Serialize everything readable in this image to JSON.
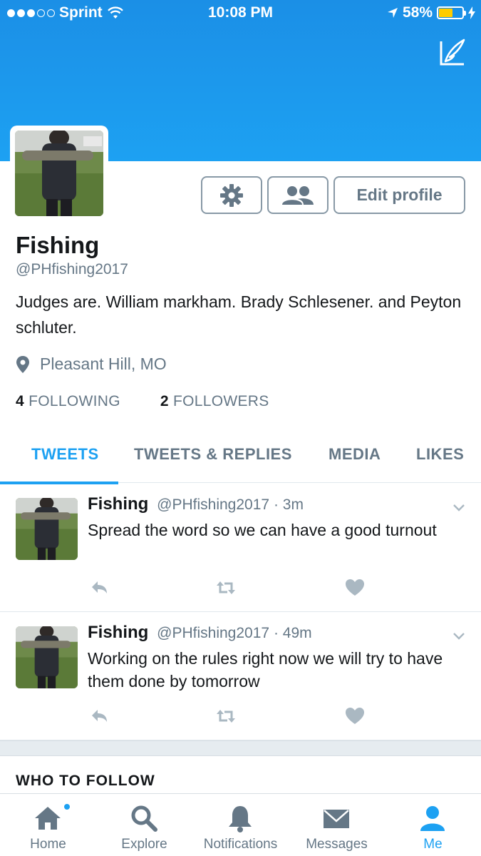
{
  "status_bar": {
    "carrier": "Sprint",
    "time": "10:08 PM",
    "battery": "58%",
    "battery_level": 0.58
  },
  "header": {
    "compose_icon": "compose-quill-icon",
    "banner_color": "#1da1f2"
  },
  "profile": {
    "name": "Fishing",
    "handle": "@PHfishing2017",
    "bio": "Judges are. William markham. Brady Schlesener. and Peyton schluter.",
    "location": "Pleasant Hill, MO",
    "following_count": "4",
    "following_label": "FOLLOWING",
    "followers_count": "2",
    "followers_label": "FOLLOWERS",
    "edit_label": "Edit profile"
  },
  "tabs": [
    {
      "label": "TWEETS",
      "active": true
    },
    {
      "label": "TWEETS & REPLIES",
      "active": false
    },
    {
      "label": "MEDIA",
      "active": false
    },
    {
      "label": "LIKES",
      "active": false
    }
  ],
  "tweets": [
    {
      "name": "Fishing",
      "handle": "@PHfishing2017",
      "sep": "·",
      "time": "3m",
      "text": "Spread the word so we can have a good turnout"
    },
    {
      "name": "Fishing",
      "handle": "@PHfishing2017",
      "sep": "·",
      "time": "49m",
      "text": "Working on the rules right now we will try to have them done by tomorrow"
    }
  ],
  "who_to_follow": "WHO TO FOLLOW",
  "tabbar": [
    {
      "label": "Home",
      "icon": "home-icon",
      "active": false
    },
    {
      "label": "Explore",
      "icon": "search-icon",
      "active": false
    },
    {
      "label": "Notifications",
      "icon": "bell-icon",
      "active": false
    },
    {
      "label": "Messages",
      "icon": "envelope-icon",
      "active": false
    },
    {
      "label": "Me",
      "icon": "person-icon",
      "active": true
    }
  ],
  "colors": {
    "accent": "#1da1f2",
    "secondary_text": "#657786",
    "primary_text": "#14171a",
    "battery_fill": "#ffcc00"
  }
}
